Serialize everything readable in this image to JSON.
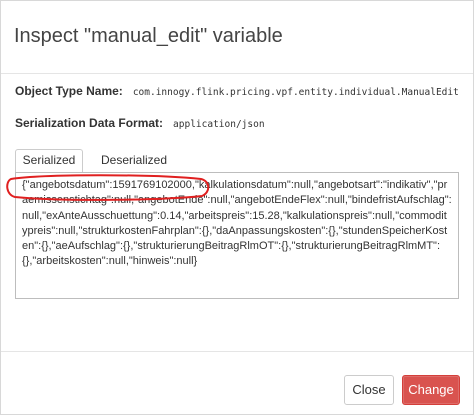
{
  "dialog": {
    "title": "Inspect \"manual_edit\" variable",
    "object_type_label": "Object Type Name:",
    "object_type_value": "com.innogy.flink.pricing.vpf.entity.individual.ManualEdit",
    "serialization_label": "Serialization Data Format:",
    "serialization_value": "application/json"
  },
  "tabs": {
    "serialized": "Serialized",
    "deserialized": "Deserialized",
    "active": "Serialized"
  },
  "serialized_value": "{\"angebotsdatum\":1591769102000,\"kalkulationsdatum\":null,\"angebotsart\":\"indikativ\",\"praemissenstichtag\":null,\"angebotEnde\":null,\"angebotEndeFlex\":null,\"bindefristAufschlag\":null,\"exAnteAusschuettung\":0.14,\"arbeitspreis\":15.28,\"kalkulationspreis\":null,\"commoditypreis\":null,\"strukturkostenFahrplan\":{},\"daAnpassungskosten\":{},\"stundenSpeicherKosten\":{},\"aeAufschlag\":{},\"strukturierungBeitragRlmOT\":{},\"strukturierungBeitragRlmMT\":{},\"arbeitskosten\":null,\"hinweis\":null}",
  "footer": {
    "close_label": "Close",
    "change_label": "Change"
  },
  "colors": {
    "annotation_circle": "#e02020",
    "primary_button": "#d9534f"
  }
}
